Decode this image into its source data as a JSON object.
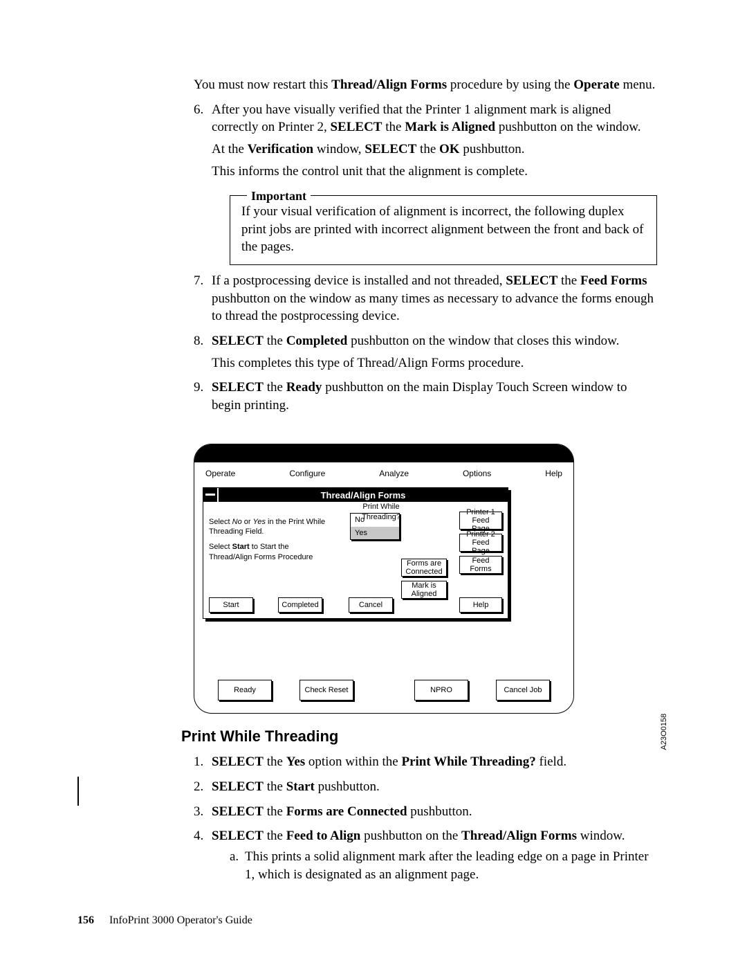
{
  "intro": {
    "p1a": "You must now restart this ",
    "p1b": "Thread/Align Forms",
    "p1c": " procedure by using the ",
    "p1d": "Operate",
    "p1e": " menu."
  },
  "steps": {
    "s6": {
      "num": "6.",
      "a1": "After you have visually verified that the Printer 1 alignment mark is aligned correctly on Printer 2, ",
      "a2": "SELECT",
      "a3": " the ",
      "a4": "Mark is Aligned",
      "a5": " pushbutton on the window.",
      "b1": "At the ",
      "b2": "Verification",
      "b3": " window, ",
      "b4": "SELECT",
      "b5": " the ",
      "b6": "OK",
      "b7": " pushbutton.",
      "c": "This informs the control unit that the alignment is complete."
    },
    "s7": {
      "num": "7.",
      "a1": "If a postprocessing device is installed and not threaded, ",
      "a2": "SELECT",
      "a3": " the ",
      "a4": "Feed Forms",
      "a5": " pushbutton on the window as many times as necessary to advance the forms enough to thread the postprocessing device."
    },
    "s8": {
      "num": "8.",
      "a1": "SELECT",
      "a2": " the ",
      "a3": "Completed",
      "a4": " pushbutton on the window that closes this window.",
      "b": "This completes this type of Thread/Align Forms procedure."
    },
    "s9": {
      "num": "9.",
      "a1": "SELECT",
      "a2": " the ",
      "a3": "Ready",
      "a4": " pushbutton on the main Display Touch Screen window to begin printing."
    }
  },
  "important": {
    "legend": "Important",
    "text": "If your visual verification of alignment is incorrect, the following duplex print jobs are printed with incorrect alignment between the front and back of the pages."
  },
  "figure": {
    "id": "A23O0158",
    "menubar": [
      "Operate",
      "Configure",
      "Analyze",
      "Options",
      "Help"
    ],
    "win_title": "Thread/Align Forms",
    "pwthead": "Print While Threading?",
    "instr1a": "Select ",
    "instr1b": "No",
    "instr1c": " or ",
    "instr1d": "Yes",
    "instr1e": " in the Print While Threading Field.",
    "instr2a": "Select ",
    "instr2b": "Start",
    "instr2c": " to Start the Thread/Align Forms Procedure",
    "list_no": "No",
    "list_yes": "Yes",
    "rbtns": [
      "Printer 1 Feed Page",
      "Printer 2 Feed Page",
      "Feed Forms"
    ],
    "midbtns": [
      "Forms are Connected",
      "Mark is Aligned"
    ],
    "bot_start": "Start",
    "bot_completed": "Completed",
    "bot_cancel": "Cancel",
    "bot_help": "Help",
    "footer_btns": {
      "ready": "Ready",
      "check": "Check Reset",
      "npro": "NPRO",
      "cancel": "Cancel Job"
    }
  },
  "section2": {
    "head": "Print While Threading",
    "s1": {
      "num": "1.",
      "a": "SELECT",
      "b": " the ",
      "c": "Yes",
      "d": " option within the ",
      "e": "Print While Threading?",
      "f": " field."
    },
    "s2": {
      "num": "2.",
      "a": "SELECT",
      "b": " the ",
      "c": "Start",
      "d": " pushbutton."
    },
    "s3": {
      "num": "3.",
      "a": "SELECT",
      "b": " the ",
      "c": "Forms are Connected",
      "d": " pushbutton."
    },
    "s4": {
      "num": "4.",
      "a": "SELECT",
      "b": " the ",
      "c": "Feed to Align",
      "d": " pushbutton on the ",
      "e": "Thread/Align Forms",
      "f": " window.",
      "sub_a_al": "a.",
      "sub_a": "This prints a solid alignment mark after the leading edge on a page in Printer 1, which is designated as an alignment page."
    }
  },
  "footer": {
    "page": "156",
    "title": "InfoPrint 3000 Operator's Guide"
  }
}
